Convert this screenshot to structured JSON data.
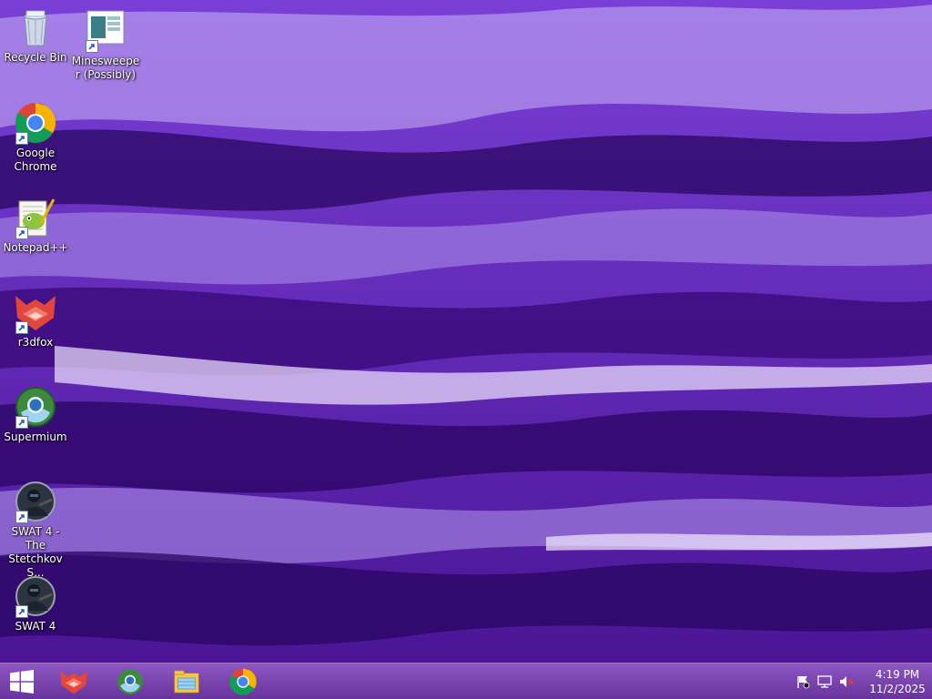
{
  "desktop": {
    "icons": [
      {
        "label": "Recycle Bin",
        "icon": "recycle-bin-icon",
        "shortcut": false
      },
      {
        "label": "Minesweeper (Possibly)",
        "icon": "minesweeper-icon",
        "shortcut": true
      },
      {
        "label": "Google Chrome",
        "icon": "chrome-icon",
        "shortcut": true
      },
      {
        "label": "Notepad++",
        "icon": "notepadpp-icon",
        "shortcut": true
      },
      {
        "label": "r3dfox",
        "icon": "r3dfox-icon",
        "shortcut": true
      },
      {
        "label": "Supermium",
        "icon": "supermium-icon",
        "shortcut": true
      },
      {
        "label": "SWAT 4 - The Stetchkov S...",
        "icon": "swat4-icon",
        "shortcut": true
      },
      {
        "label": "SWAT 4",
        "icon": "swat4-icon",
        "shortcut": true
      }
    ]
  },
  "taskbar": {
    "pinned": [
      "windows-start-icon",
      "r3dfox-icon",
      "supermium-icon",
      "file-explorer-icon",
      "chrome-icon"
    ],
    "tray": [
      "action-center-flag-icon",
      "network-icon",
      "volume-muted-icon"
    ],
    "clock": {
      "time": "4:19 PM",
      "date": "11/2/2025"
    }
  },
  "colors": {
    "wallpaper_base": "#5c1fb0",
    "taskbar": "#7a3cb8",
    "label_text": "#ffffff"
  }
}
